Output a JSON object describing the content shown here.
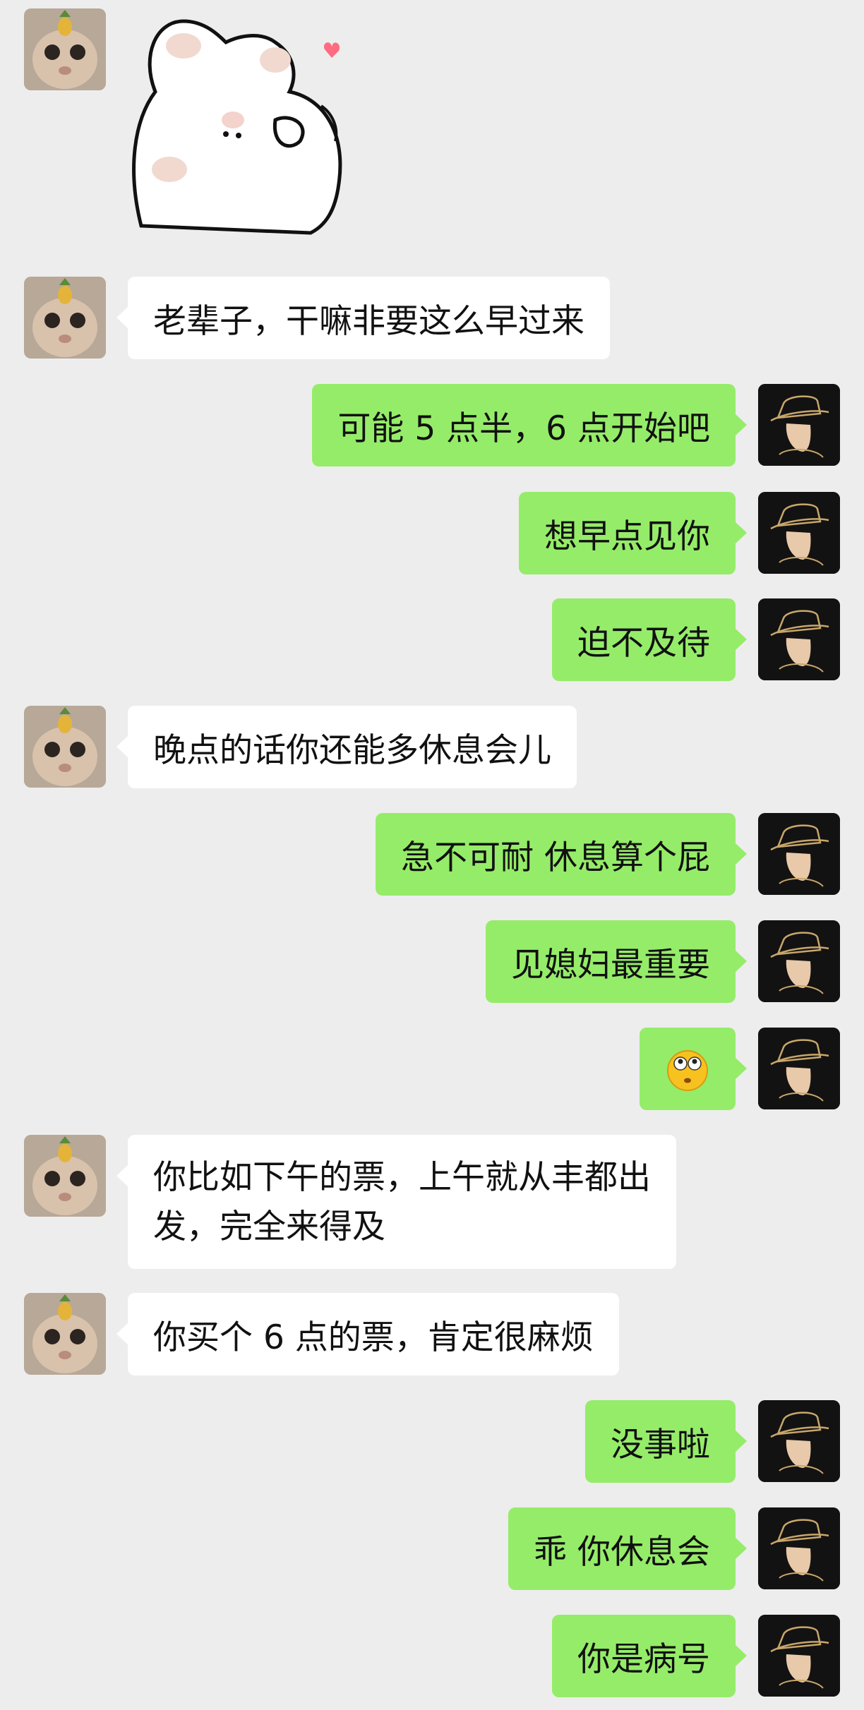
{
  "chat": {
    "messages": [
      {
        "sender": "contact",
        "kind": "sticker",
        "sticker": "white-bunny-heart-sticker"
      },
      {
        "sender": "contact",
        "text": "老辈子，干嘛非要这么早过来"
      },
      {
        "sender": "me",
        "text": "可能 5 点半，6 点开始吧"
      },
      {
        "sender": "me",
        "text": "想早点见你"
      },
      {
        "sender": "me",
        "text": "迫不及待"
      },
      {
        "sender": "contact",
        "text": "晚点的话你还能多休息会儿"
      },
      {
        "sender": "me",
        "text": "急不可耐 休息算个屁"
      },
      {
        "sender": "me",
        "text": "见媳妇最重要"
      },
      {
        "sender": "me",
        "kind": "emoji",
        "emoji": "flushed-face-emoji"
      },
      {
        "sender": "contact",
        "lines": [
          "你比如下午的票，上午就从丰都出",
          "发，完全来得及"
        ]
      },
      {
        "sender": "contact",
        "text": "你买个 6 点的票，肯定很麻烦"
      },
      {
        "sender": "me",
        "text": "没事啦"
      },
      {
        "sender": "me",
        "text": "乖 你休息会"
      },
      {
        "sender": "me",
        "text": "你是病号"
      }
    ]
  },
  "avatars": {
    "contact": {
      "icon": "cat-with-pineapple-avatar"
    },
    "me": {
      "icon": "hat-silhouette-avatar"
    }
  },
  "colors": {
    "background": "#ededed",
    "incoming_bubble": "#ffffff",
    "outgoing_bubble": "#95ec69"
  }
}
